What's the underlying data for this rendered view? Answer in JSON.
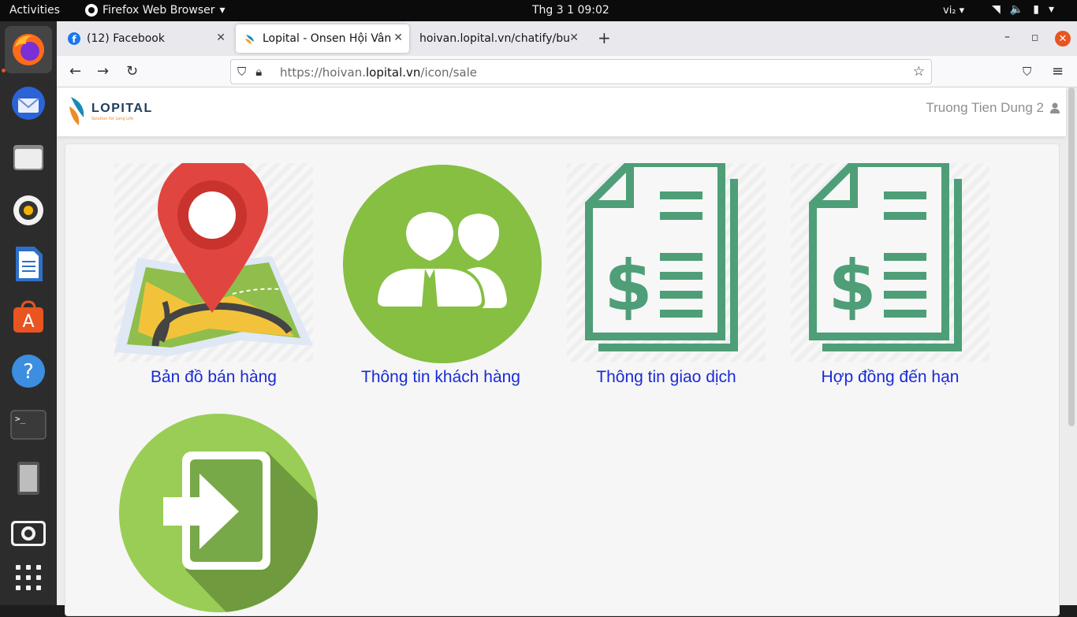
{
  "topbar": {
    "activities": "Activities",
    "app_name": "Firefox Web Browser",
    "clock": "Thg 3 1  09:02",
    "input_method": "vi₂"
  },
  "dock": {
    "items": [
      "firefox",
      "thunderbird",
      "files",
      "rhythmbox",
      "libreoffice-writer",
      "ubuntu-software",
      "help",
      "terminal",
      "tablet",
      "screenshot",
      "show-apps"
    ]
  },
  "tabs": [
    {
      "title": "(12) Facebook"
    },
    {
      "title": "Lopital - Onsen Hội Vân"
    },
    {
      "title": "hoivan.lopital.vn/chatify/bui"
    }
  ],
  "urlbar": {
    "prefix": "https://hoivan.",
    "domain": "lopital.vn",
    "path": "/icon/sale"
  },
  "site": {
    "brand": "LOPITAL",
    "tagline": "Solution for Long Life",
    "user_name": "Truong Tien Dung 2"
  },
  "tiles": [
    {
      "label": "Bản đồ bán hàng"
    },
    {
      "label": "Thông tin khách hàng"
    },
    {
      "label": "Thông tin giao dịch"
    },
    {
      "label": "Hợp đồng đến hạn"
    },
    {
      "label": ""
    }
  ],
  "colors": {
    "link": "#1a2bd6",
    "green_circle": "#86bf42",
    "invoice_green": "#4e9e78",
    "pin_red": "#e0463f"
  }
}
